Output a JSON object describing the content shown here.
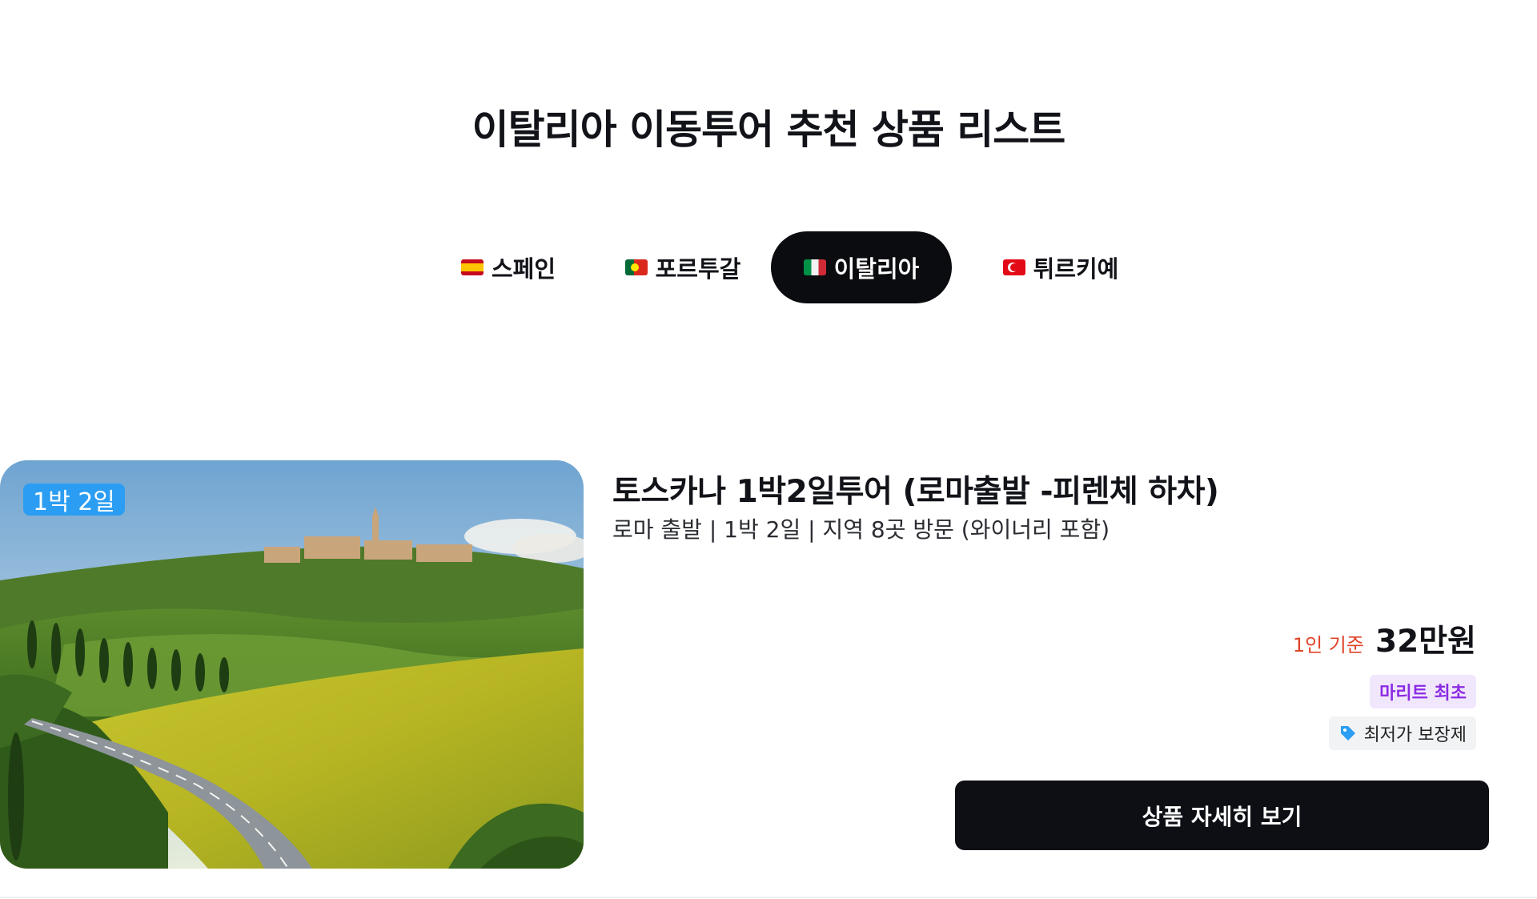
{
  "page": {
    "title": "이탈리아 이동투어 추천 상품 리스트"
  },
  "tabs": [
    {
      "label": "스페인",
      "flag": "spain-flag-icon"
    },
    {
      "label": "포르투갈",
      "flag": "portugal-flag-icon"
    },
    {
      "label": "이탈리아",
      "flag": "italy-flag-icon",
      "active": true
    },
    {
      "label": "튀르키예",
      "flag": "turkiye-flag-icon"
    }
  ],
  "product": {
    "duration_badge": "1박 2일",
    "title": "토스카나 1박2일투어 (로마출발 -피렌체 하차)",
    "subtitle": "로마 출발 | 1박 2일  | 지역 8곳 방문 (와이너리 포함)",
    "price_basis": "1인 기준",
    "price": "32만원",
    "badge_marit": "마리트 최초",
    "badge_lowest": "최저가 보장제",
    "button_label": "상품 자세히 보기",
    "image": "tuscany-landscape-image"
  },
  "colors": {
    "accent": "#0b0c0f",
    "badge_blue": "#2b9df2",
    "price_basis_red": "#e0442a",
    "marit_purple": "#8b2be2"
  }
}
